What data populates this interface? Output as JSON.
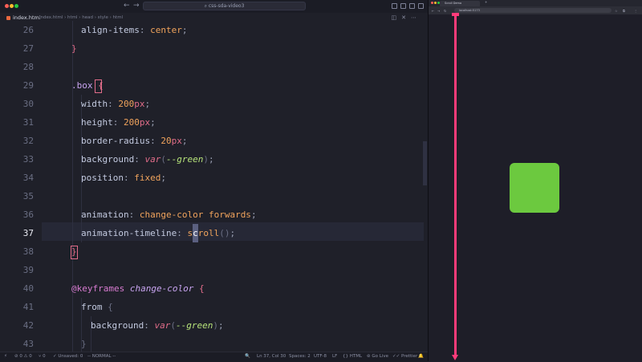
{
  "titlebar": {
    "search_text": "css-sda-video3"
  },
  "editor": {
    "tab_label": "index.html",
    "breadcrumb": "index.html › html › head › style › html",
    "lines": [
      {
        "n": "26"
      },
      {
        "n": "27"
      },
      {
        "n": "28"
      },
      {
        "n": "29"
      },
      {
        "n": "30"
      },
      {
        "n": "31"
      },
      {
        "n": "32"
      },
      {
        "n": "33"
      },
      {
        "n": "34"
      },
      {
        "n": "35"
      },
      {
        "n": "36"
      },
      {
        "n": "37"
      },
      {
        "n": "38"
      },
      {
        "n": "39"
      },
      {
        "n": "40"
      },
      {
        "n": "41"
      },
      {
        "n": "42"
      },
      {
        "n": "43"
      }
    ],
    "code": {
      "l26_prop": "align-items",
      "l26_val": "center",
      "l29_sel": ".box",
      "l30_prop": "width",
      "l30_num": "200",
      "l30_unit": "px",
      "l31_prop": "height",
      "l31_num": "200",
      "l31_unit": "px",
      "l32_prop": "border-radius",
      "l32_num": "20",
      "l32_unit": "px",
      "l33_prop": "background",
      "l33_fn": "var",
      "l33_var": "--green",
      "l34_prop": "position",
      "l34_val": "fixed",
      "l36_prop": "animation",
      "l36_val": "change-color forwards",
      "l37_prop": "animation-timeline",
      "l37_pre": "s",
      "l37_cur": "c",
      "l37_post": "roll",
      "l40_at": "@keyframes",
      "l40_name": "change-color",
      "l41_kw": "from",
      "l42_prop": "background",
      "l42_fn": "var",
      "l42_var": "--green"
    }
  },
  "status": {
    "problems": "⊘ 0 ⚠ 0",
    "ports": "0",
    "unsaved": "Unsaved: 0",
    "mode": "-- NORMAL --",
    "position": "Ln 37, Col 30",
    "spaces": "Spaces: 2",
    "encoding": "UTF-8",
    "eol": "LF",
    "language": "HTML",
    "golive": "Go Live",
    "prettier": "Prettier"
  },
  "browser": {
    "tab_title": "Scroll Demo",
    "url": "localhost:5173"
  },
  "colors": {
    "green_box": "#6cc93f",
    "timeline_line": "#ff3b7a"
  }
}
